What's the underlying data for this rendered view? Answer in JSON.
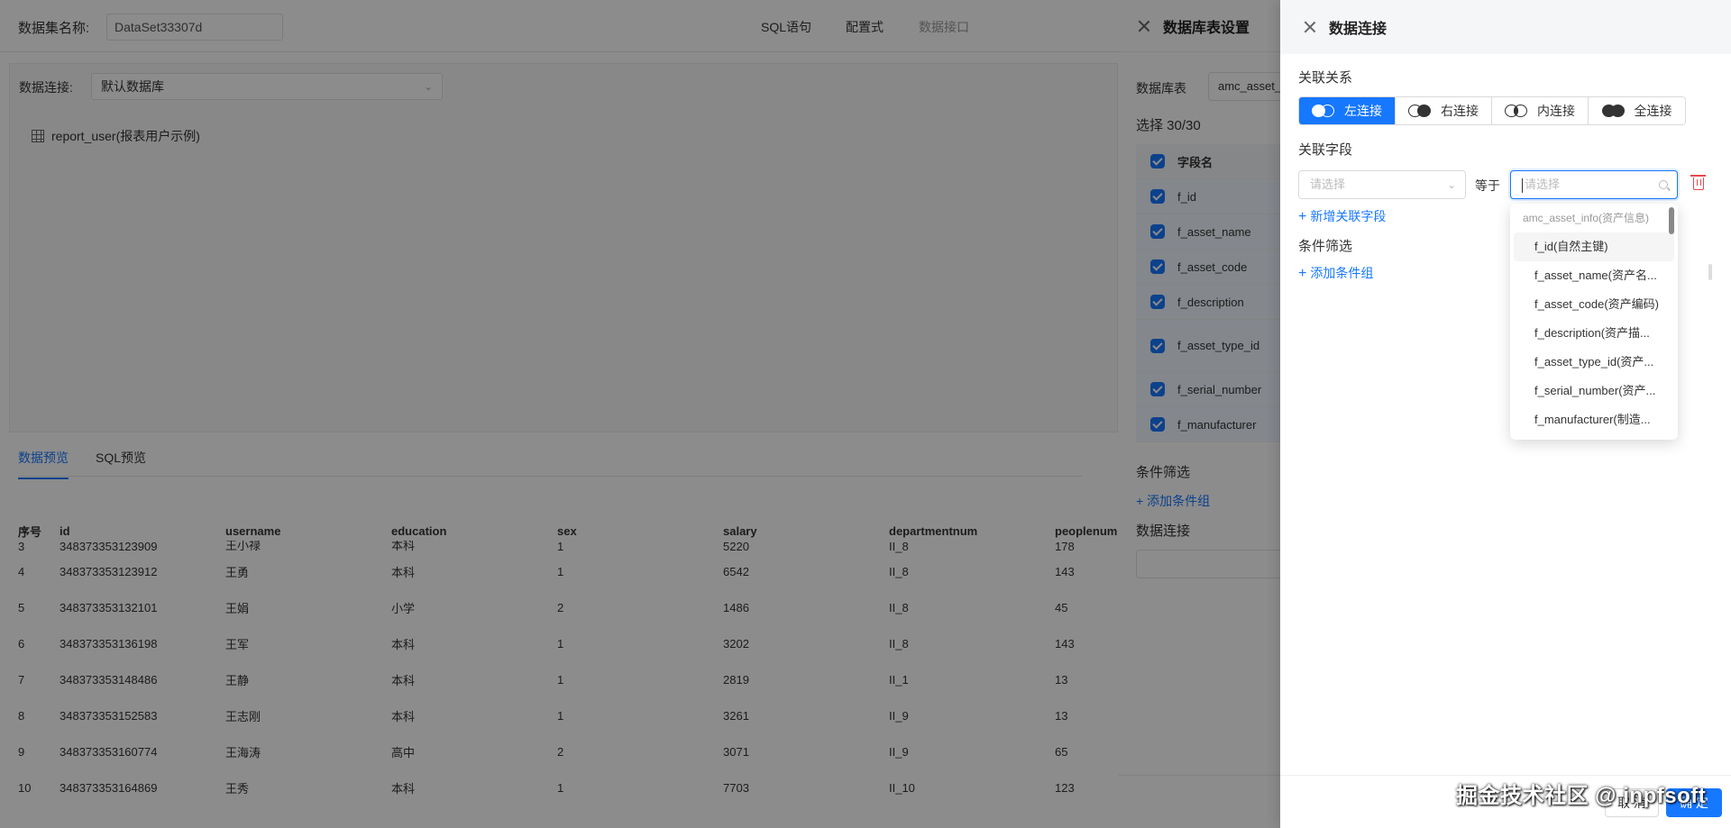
{
  "topbar": {
    "dataset_label": "数据集名称:",
    "dataset_value": "DataSet33307d",
    "tabs": [
      "SQL语句",
      "配置式",
      "数据接口"
    ]
  },
  "left_panel": {
    "connection_label": "数据连接:",
    "connection_value": "默认数据库",
    "table_item": "report_user(报表用户示例)"
  },
  "preview": {
    "tabs": [
      "数据预览",
      "SQL预览"
    ],
    "columns": [
      "序号",
      "id",
      "username",
      "education",
      "sex",
      "salary",
      "departmentnum",
      "peoplenum"
    ],
    "partial_row": [
      "3",
      "348373353123909",
      "王小禄",
      "本科",
      "1",
      "5220",
      "II_8",
      "178"
    ],
    "rows": [
      [
        "4",
        "348373353123912",
        "王勇",
        "本科",
        "1",
        "6542",
        "II_8",
        "143"
      ],
      [
        "5",
        "348373353132101",
        "王娟",
        "小学",
        "2",
        "1486",
        "II_8",
        "45"
      ],
      [
        "6",
        "348373353136198",
        "王军",
        "本科",
        "1",
        "3202",
        "II_8",
        "143"
      ],
      [
        "7",
        "348373353148486",
        "王静",
        "本科",
        "1",
        "2819",
        "II_1",
        "13"
      ],
      [
        "8",
        "348373353152583",
        "王志刚",
        "本科",
        "1",
        "3261",
        "II_9",
        "13"
      ],
      [
        "9",
        "348373353160774",
        "王海涛",
        "高中",
        "2",
        "3071",
        "II_9",
        "65"
      ],
      [
        "10",
        "348373353164869",
        "王秀",
        "本科",
        "1",
        "7703",
        "II_10",
        "123"
      ]
    ]
  },
  "mid_drawer": {
    "title": "数据库表设置",
    "db_table_label": "数据库表",
    "db_table_value": "amc_asset_",
    "select_count": "选择 30/30",
    "field_header": "字段名",
    "fields": [
      "f_id",
      "f_asset_name",
      "f_asset_code",
      "f_description",
      "f_asset_type_id",
      "f_serial_number",
      "f_manufacturer"
    ],
    "condition_title": "条件筛选",
    "add_condition_group": "添加条件组",
    "connection_title": "数据连接"
  },
  "right_drawer": {
    "title": "数据连接",
    "relation_title": "关联关系",
    "join_types": [
      "左连接",
      "右连接",
      "内连接",
      "全连接"
    ],
    "active_join": "左连接",
    "field_title": "关联字段",
    "left_placeholder": "请选择",
    "equals": "等于",
    "right_placeholder": "请选择",
    "add_field": "新增关联字段",
    "condition_title": "条件筛选",
    "add_condition_group": "添加条件组",
    "dropdown": {
      "group": "amc_asset_info(资产信息)",
      "items": [
        "f_id(自然主键)",
        "f_asset_name(资产名...",
        "f_asset_code(资产编码)",
        "f_description(资产描...",
        "f_asset_type_id(资产...",
        "f_serial_number(资产...",
        "f_manufacturer(制造..."
      ]
    },
    "cancel": "取 消",
    "ok": "确 定"
  },
  "watermark": "掘金技术社区 @ inpfsoft",
  "colors": {
    "primary": "#1677ff",
    "danger": "#e5484d",
    "mask": "rgba(0,0,0,0.45)"
  }
}
